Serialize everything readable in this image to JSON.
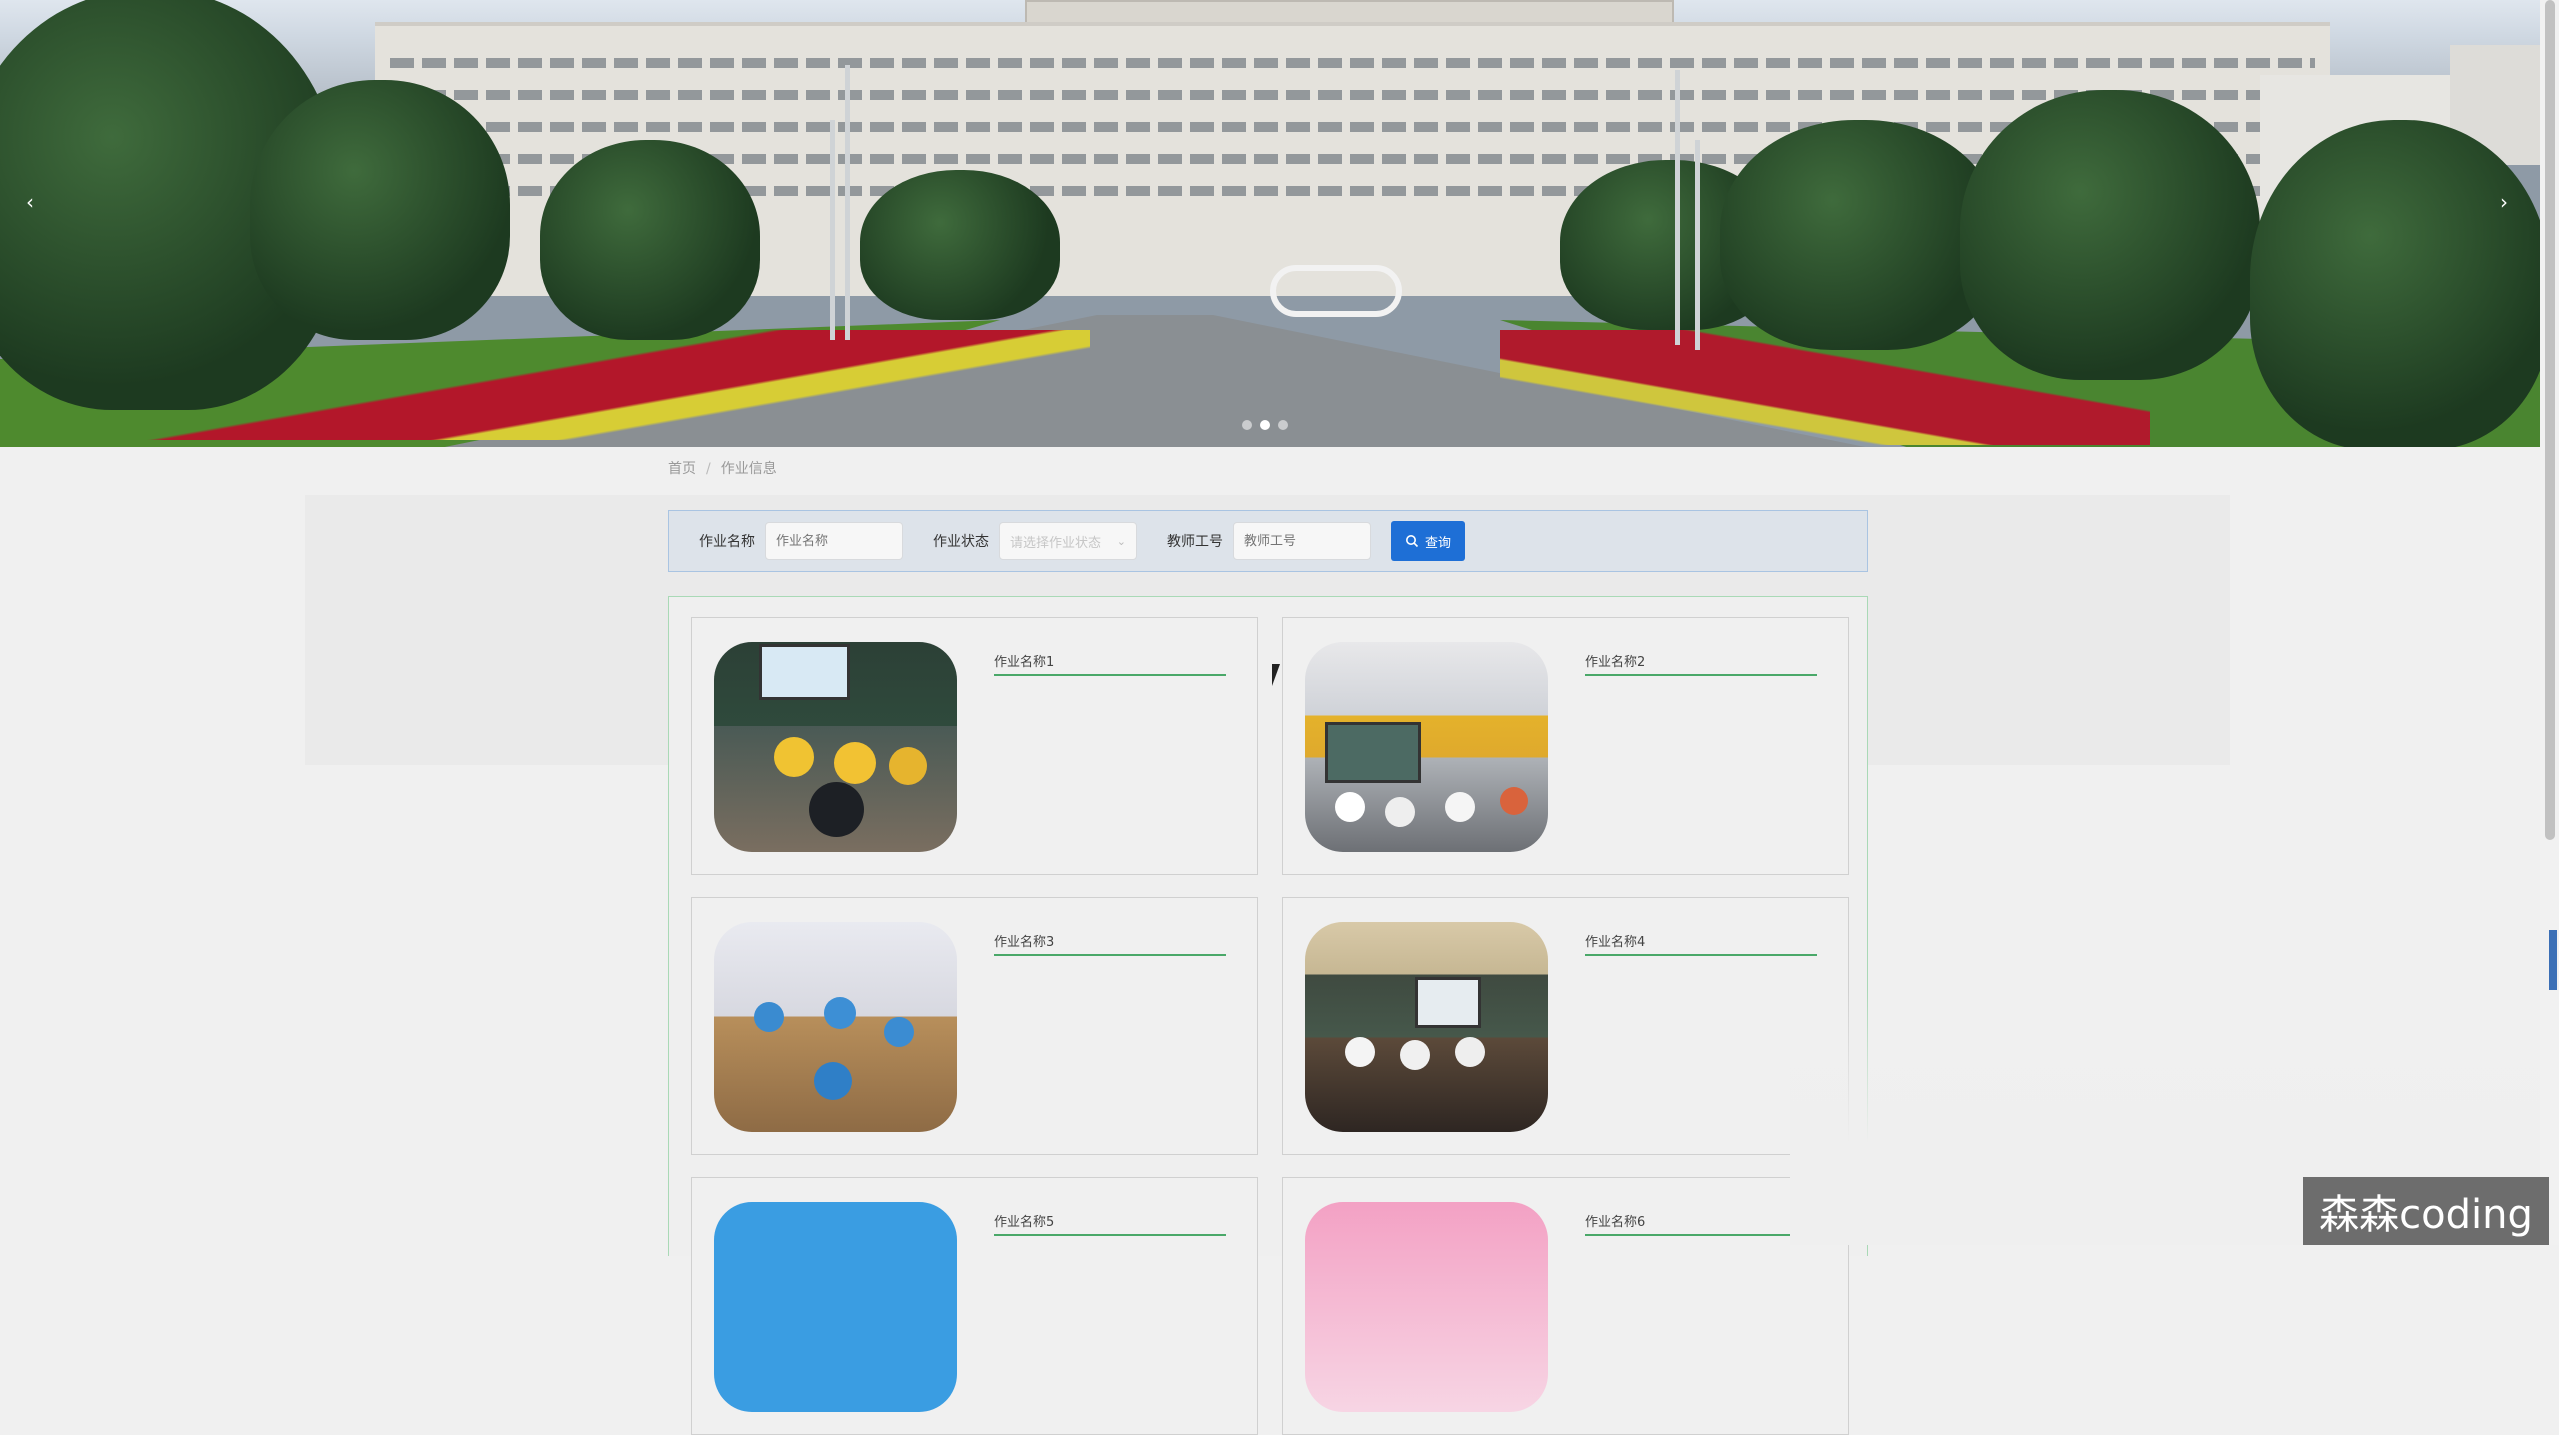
{
  "banner": {
    "prev_icon": "chevron-left-icon",
    "next_icon": "chevron-right-icon",
    "prev_glyph": "‹",
    "next_glyph": "›",
    "slide_count": 3,
    "active_slide": 2
  },
  "breadcrumb": {
    "home": "首页",
    "separator": "/",
    "current": "作业信息"
  },
  "search": {
    "name_label": "作业名称",
    "name_placeholder": "作业名称",
    "status_label": "作业状态",
    "status_placeholder": "请选择作业状态",
    "teacher_label": "教师工号",
    "teacher_placeholder": "教师工号",
    "query_button": "查询",
    "query_icon": "search-icon",
    "accent_color": "#1e6fd6"
  },
  "cards": [
    {
      "title": "作业名称1"
    },
    {
      "title": "作业名称2"
    },
    {
      "title": "作业名称3"
    },
    {
      "title": "作业名称4"
    },
    {
      "title": "作业名称5"
    },
    {
      "title": "作业名称6"
    }
  ],
  "watermark": "森森coding",
  "colors": {
    "card_title_underline": "#4aa869",
    "grid_border": "#a9d9b6",
    "search_border": "#a9c4e2"
  }
}
